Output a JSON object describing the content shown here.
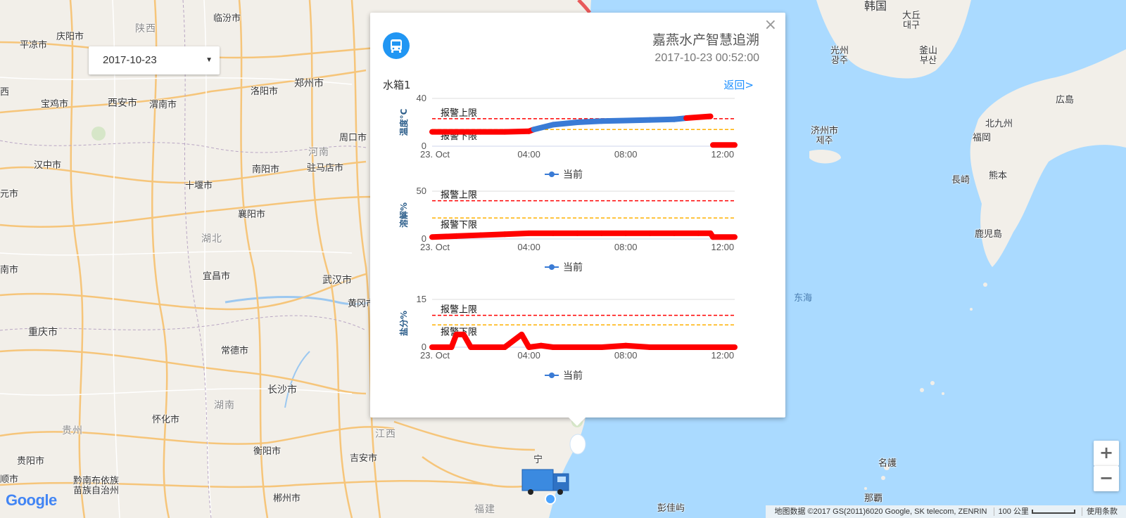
{
  "map": {
    "labels": {
      "pingliang": "平凉市",
      "qingyang": "庆阳市",
      "shaanxi": "陕西",
      "linfen": "临汾市",
      "baoji": "宝鸡市",
      "xian": "西安市",
      "weinan": "渭南市",
      "luoyang": "洛阳市",
      "zhengzhou": "郑州市",
      "hanzhong": "汉中市",
      "shiyan": "十堰市",
      "nanyang": "南阳市",
      "zhumadian": "驻马店市",
      "henan": "河南",
      "zhoukou": "周口市",
      "xiangyang": "襄阳市",
      "hubei": "湖北",
      "yichang": "宜昌市",
      "wuhan": "武汉市",
      "huanggang": "黄冈市",
      "chongqing": "重庆市",
      "changde": "常德市",
      "changsha": "长沙市",
      "hunan": "湖南",
      "huaihua": "怀化市",
      "hengyang": "衡阳市",
      "guizhou": "贵州",
      "jiangxi": "江西",
      "jian": "吉安市",
      "guiyang": "贵阳市",
      "qiannan1": "黔南布依族",
      "qiannan2": "苗族自治州",
      "chenzhou": "郴州市",
      "fujian": "福建",
      "pengjia": "彭佳屿",
      "hanguo": "韩国",
      "daegu1": "大丘",
      "daegu2": "대구",
      "gwangju1": "光州",
      "gwangju2": "광주",
      "busan1": "釜山",
      "busan2": "부산",
      "jeju1": "济州市",
      "jeju2": "제주",
      "kitakyushu": "北九州",
      "hiroshima": "広島",
      "fukuoka": "福岡",
      "nagasaki": "長崎",
      "kumamoto": "熊本",
      "kagoshima": "鹿児島",
      "donghai": "东海",
      "nago": "名護",
      "naha": "那覇",
      "xi": "西",
      "ning": "宁",
      "yuan": "元市",
      "nan": "南市",
      "shun": "顺市",
      "fu": "福"
    }
  },
  "date_select": {
    "value": "2017-10-23"
  },
  "popup": {
    "title": "嘉燕水产智慧追溯",
    "timestamp": "2017-10-23 00:52:00",
    "tank_label": "水箱1",
    "back_link": "返回>",
    "close": "×",
    "legend_label": "当前",
    "upper_limit_label": "报警上限",
    "lower_limit_label": "报警下限"
  },
  "chart_data": [
    {
      "type": "line",
      "ylabel": "温度°C",
      "ylim": [
        0,
        40
      ],
      "yticks": [
        0,
        40
      ],
      "xticks": [
        "23. Oct",
        "04:00",
        "08:00",
        "12:00"
      ],
      "upper_limit": 23,
      "lower_limit": 14,
      "colors": {
        "upper": "#ff0000",
        "lower": "#ffb000",
        "normal": "#3a7bd5",
        "alarm": "#ff0000"
      },
      "series": [
        {
          "name": "当前",
          "x": [
            0,
            1,
            2,
            3,
            4,
            4.2,
            5,
            6,
            7,
            8,
            9,
            10,
            10.5,
            11.5,
            11.6,
            12.5
          ],
          "values": [
            12,
            12,
            12,
            12,
            12.5,
            14,
            18,
            20,
            21,
            21.5,
            22,
            22.5,
            23.5,
            25,
            1,
            1
          ]
        }
      ]
    },
    {
      "type": "line",
      "ylabel": "溶解%",
      "ylim": [
        0,
        50
      ],
      "yticks": [
        0,
        50
      ],
      "xticks": [
        "23. Oct",
        "04:00",
        "08:00",
        "12:00"
      ],
      "upper_limit": 40,
      "lower_limit": 22,
      "colors": {
        "upper": "#ff0000",
        "lower": "#ffb000",
        "normal": "#3a7bd5",
        "alarm": "#ff0000"
      },
      "series": [
        {
          "name": "当前",
          "x": [
            0,
            1,
            2,
            3,
            4,
            5,
            6,
            7,
            8,
            9,
            10,
            11,
            11.5,
            11.6,
            12.5
          ],
          "values": [
            2,
            3,
            4,
            5,
            6,
            6,
            6,
            6,
            6,
            6,
            6,
            6,
            6,
            2,
            2
          ]
        }
      ]
    },
    {
      "type": "line",
      "ylabel": "盐分%",
      "ylim": [
        0,
        15
      ],
      "yticks": [
        0,
        15
      ],
      "xticks": [
        "23. Oct",
        "04:00",
        "08:00",
        "12:00"
      ],
      "upper_limit": 10,
      "lower_limit": 7,
      "colors": {
        "upper": "#ff0000",
        "lower": "#ffb000",
        "normal": "#3a7bd5",
        "alarm": "#ff0000"
      },
      "series": [
        {
          "name": "当前",
          "x": [
            0,
            0.8,
            1,
            1.3,
            1.6,
            2,
            3,
            3.7,
            4,
            4.5,
            5,
            6,
            7,
            8,
            9,
            10,
            11,
            12,
            12.5
          ],
          "values": [
            0,
            0,
            4,
            4,
            0,
            0,
            0,
            4,
            0,
            0.5,
            0,
            0,
            0,
            0.5,
            0,
            0,
            0,
            0,
            0
          ]
        }
      ]
    }
  ],
  "controls": {
    "zoom_in": "+",
    "zoom_out": "−"
  },
  "google_logo": "Google",
  "attribution": {
    "data": "地图数据 ©2017 GS(2011)6020 Google, SK telecom, ZENRIN",
    "scale": "100 公里",
    "terms": "使用条款"
  }
}
